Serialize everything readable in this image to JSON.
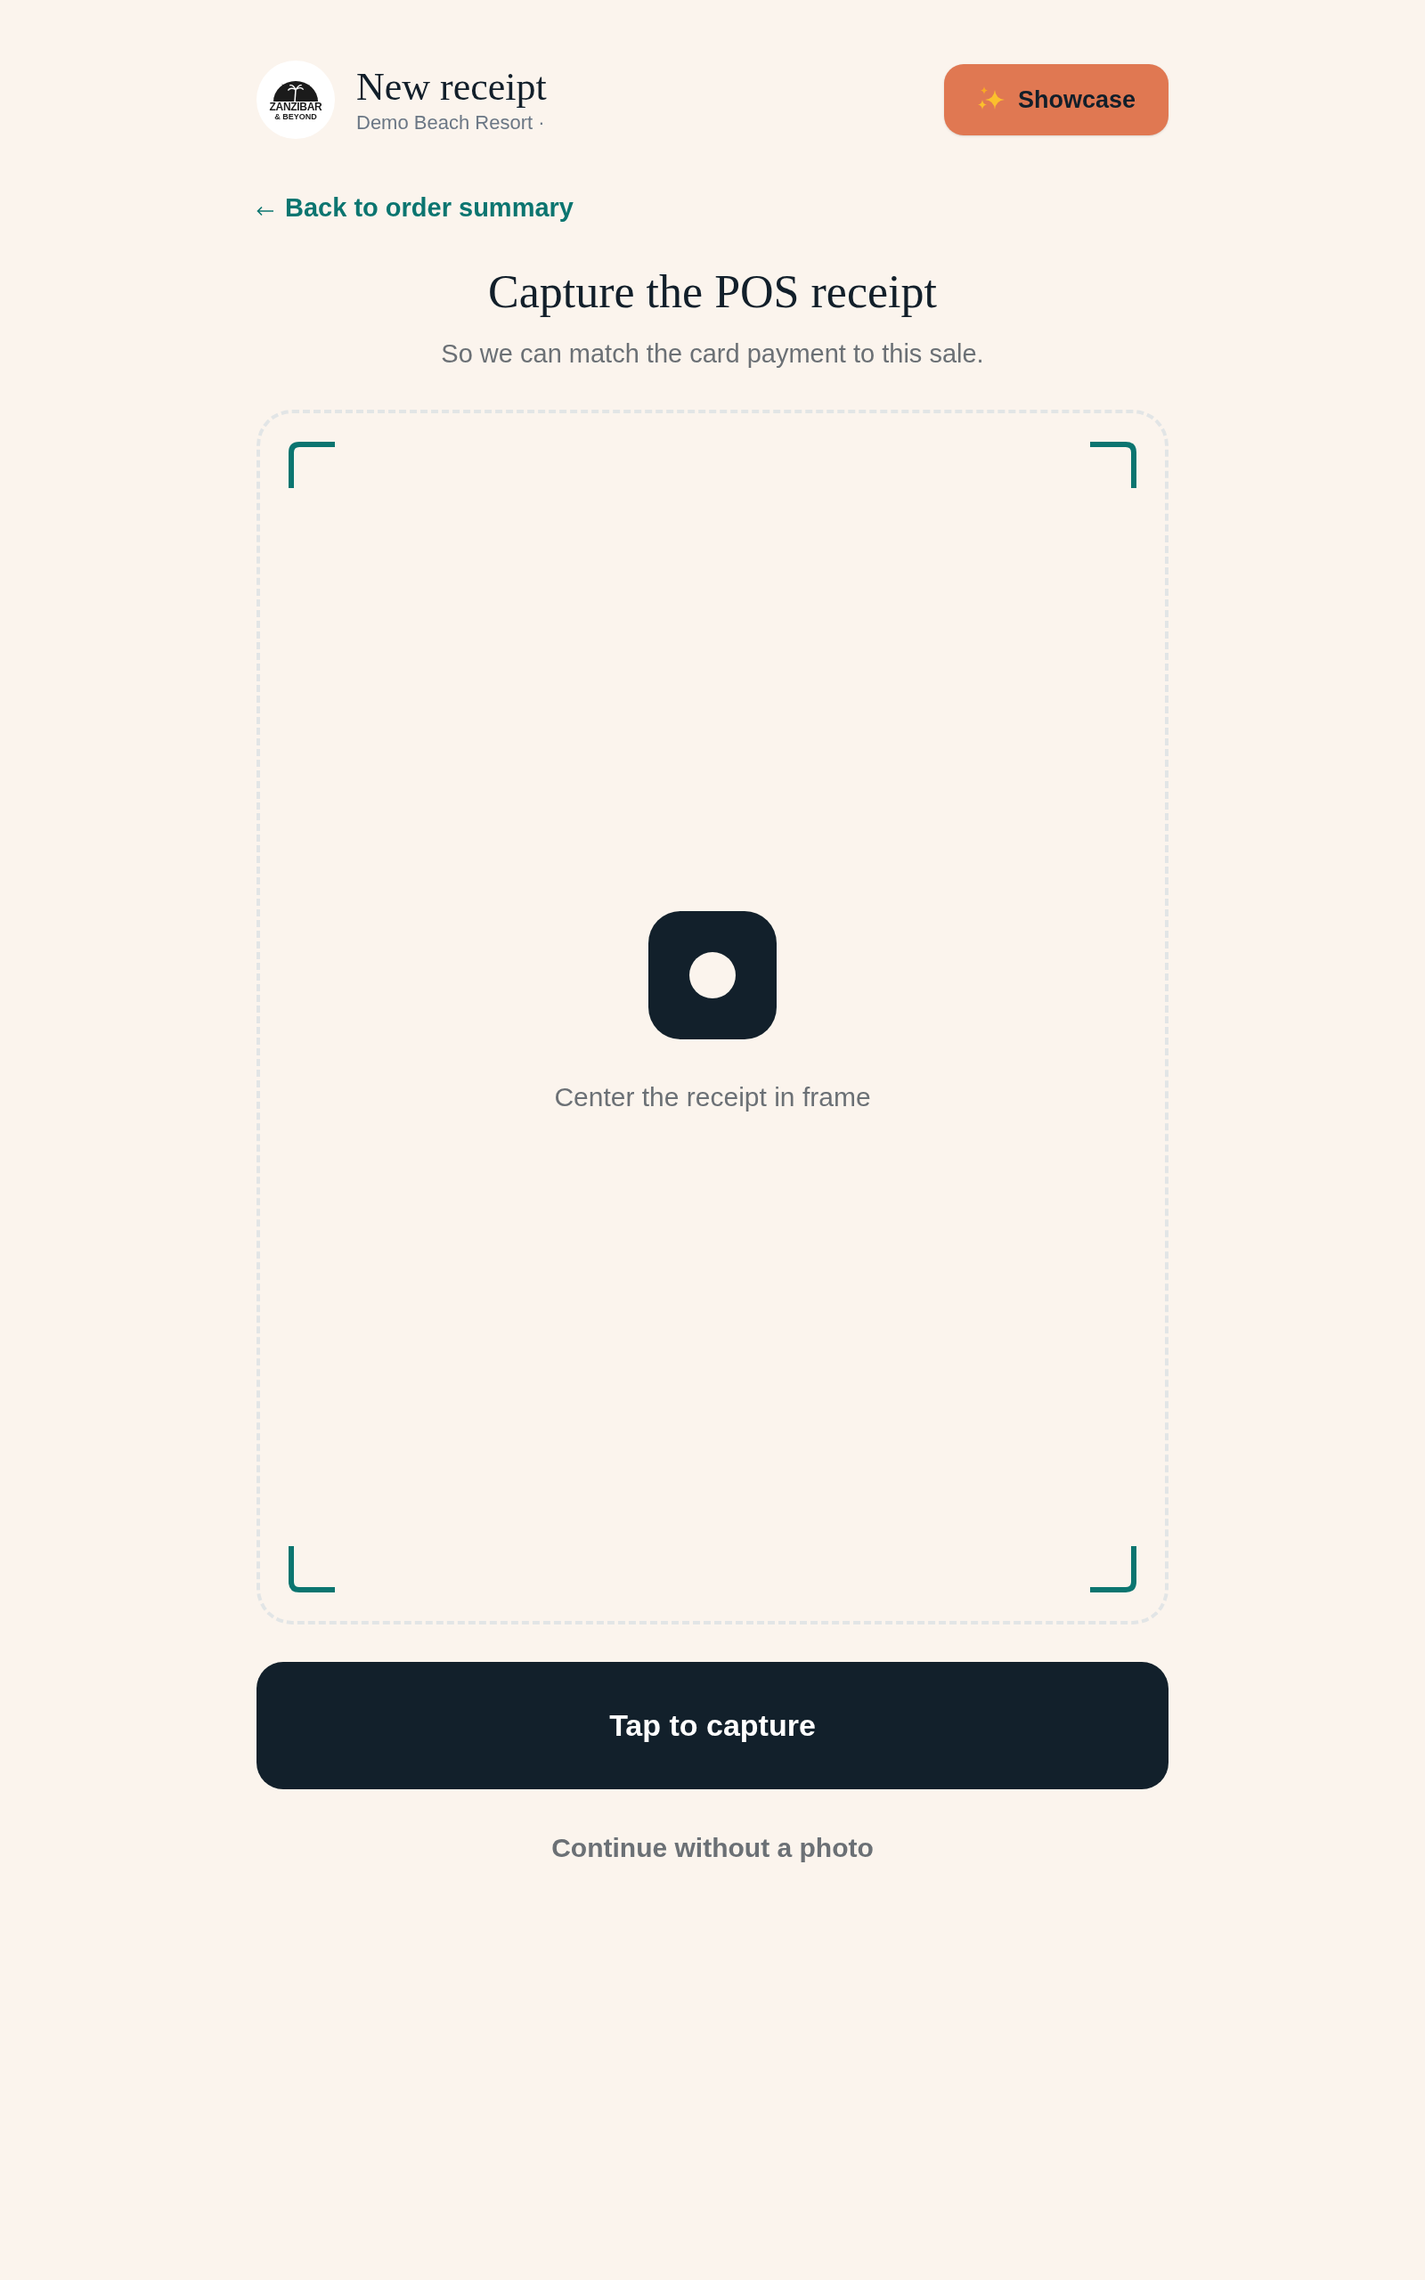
{
  "header": {
    "logo": {
      "lines": [
        "ZANZIBAR",
        "& BEYOND"
      ]
    },
    "title": "New receipt",
    "subtitle": "Demo Beach Resort ·",
    "showcase_button": "Showcase"
  },
  "back_link": "Back to order summary",
  "heading": "Capture the POS receipt",
  "description": "So we can match the card payment to this sale.",
  "viewfinder": {
    "hint": "Center the receipt in frame"
  },
  "primary_button": "Tap to capture",
  "secondary_link": "Continue without a photo"
}
